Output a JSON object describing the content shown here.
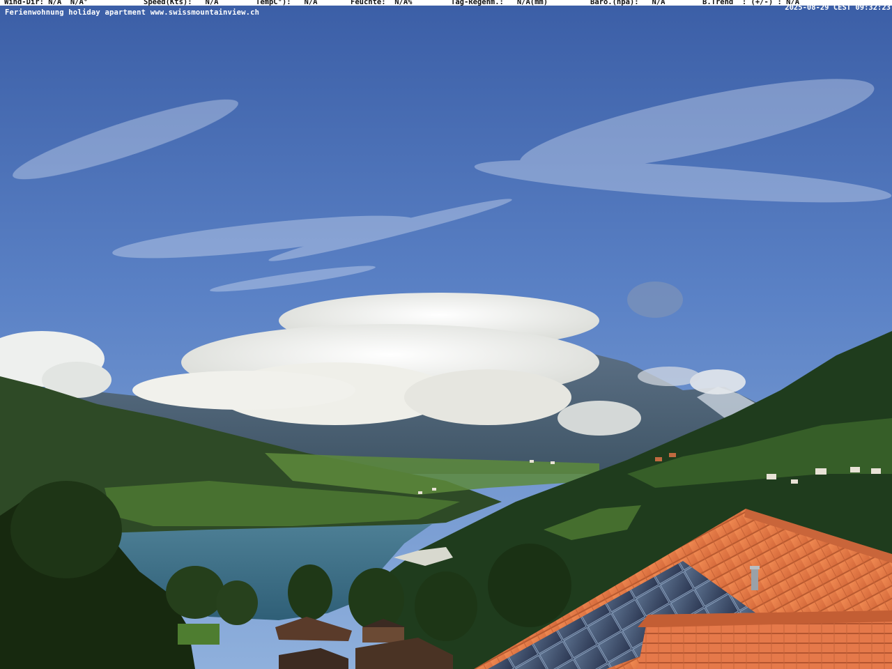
{
  "weather_bar": {
    "wind_dir": "Wind-Dir: N/A  N/A°",
    "speed": "Speed(Kts):   N/A",
    "temp": "TempC°):   N/A",
    "humidity": "Feuchte:  N/A%",
    "rain": "Tag-Regenm.:   N/A(mm)",
    "baro": "Baro.(hpa):   N/A",
    "trend": "B.Trend  : (+/-) : N/A"
  },
  "timestamp": "2025-08-29 CEST 09:32:23",
  "caption": "Ferienwohnung holiday apartment www.swissmountainview.ch",
  "colors": {
    "sky_top": "#3a5fa8",
    "sky_bottom": "#7fa6d6",
    "lake": "#3d6f86",
    "roof_tile": "#e07844",
    "forest": "#22401f"
  }
}
